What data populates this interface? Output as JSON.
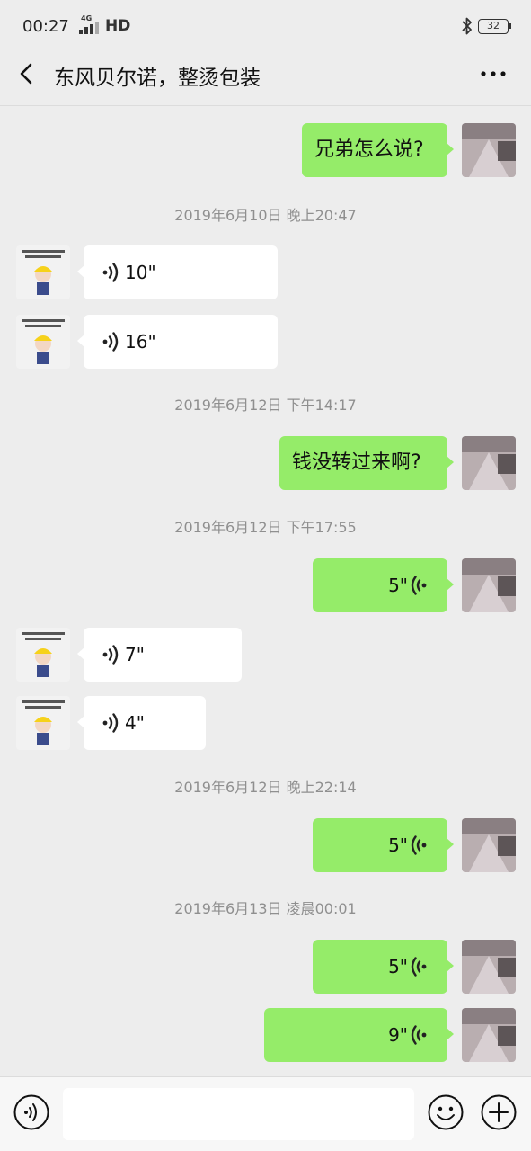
{
  "status_bar": {
    "time": "00:27",
    "network_label": "4G",
    "hd": "HD",
    "battery": "32"
  },
  "header": {
    "title": "东风贝尔诺，整烫包装"
  },
  "contact_avatar_caption": "老板，我随时等候您的订单。",
  "messages": [
    {
      "text": "兄弟怎么说?"
    },
    {
      "timestamp": "2019年6月10日 晚上20:47"
    },
    {
      "voice_duration": "10\""
    },
    {
      "voice_duration": "16\""
    },
    {
      "timestamp": "2019年6月12日 下午14:17"
    },
    {
      "text": "钱没转过来啊?"
    },
    {
      "timestamp": "2019年6月12日 下午17:55"
    },
    {
      "voice_duration": "5\""
    },
    {
      "voice_duration": "7\""
    },
    {
      "voice_duration": "4\""
    },
    {
      "timestamp": "2019年6月12日 晚上22:14"
    },
    {
      "voice_duration": "5\""
    },
    {
      "timestamp": "2019年6月13日 凌晨00:01"
    },
    {
      "voice_duration": "5\""
    },
    {
      "voice_duration": "9\""
    }
  ],
  "colors": {
    "outgoing_bubble": "#95ec69",
    "incoming_bubble": "#ffffff",
    "background": "#ededed"
  }
}
